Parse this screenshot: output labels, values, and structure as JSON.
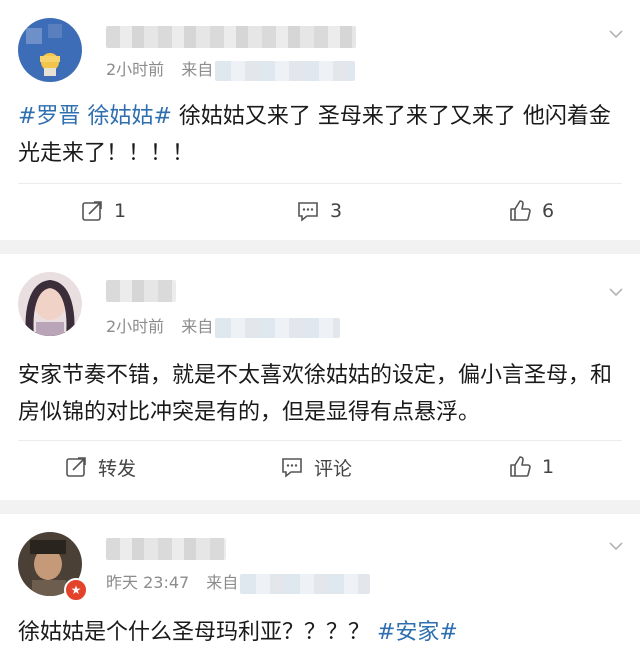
{
  "posts": [
    {
      "time": "2小时前",
      "source_prefix": "来自",
      "content_tags": [
        "#罗晋",
        "徐姑姑#"
      ],
      "content_text": " 徐姑姑又来了 圣母来了来了又来了 他闪着金光走来了！！！！",
      "actions": {
        "repost": "1",
        "comment": "3",
        "like": "6"
      }
    },
    {
      "time": "2小时前",
      "source_prefix": "来自",
      "content_text": "安家节奏不错，就是不太喜欢徐姑姑的设定，偏小言圣母，和房似锦的对比冲突是有的，但是显得有点悬浮。",
      "actions": {
        "repost": "转发",
        "comment": "评论",
        "like": "1"
      }
    },
    {
      "time": "昨天 23:47",
      "source_prefix": "来自",
      "content_text": "徐姑姑是个什么圣母玛利亚？？？？ ",
      "content_tag_end": "#安家#"
    }
  ],
  "icons": {
    "chevron": "chevron-down-icon",
    "repost": "repost-icon",
    "comment": "comment-icon",
    "like": "thumbs-up-icon"
  },
  "colors": {
    "link": "#2f6fb0",
    "meta": "#8c8c8c",
    "separator": "#f2f2f2"
  }
}
